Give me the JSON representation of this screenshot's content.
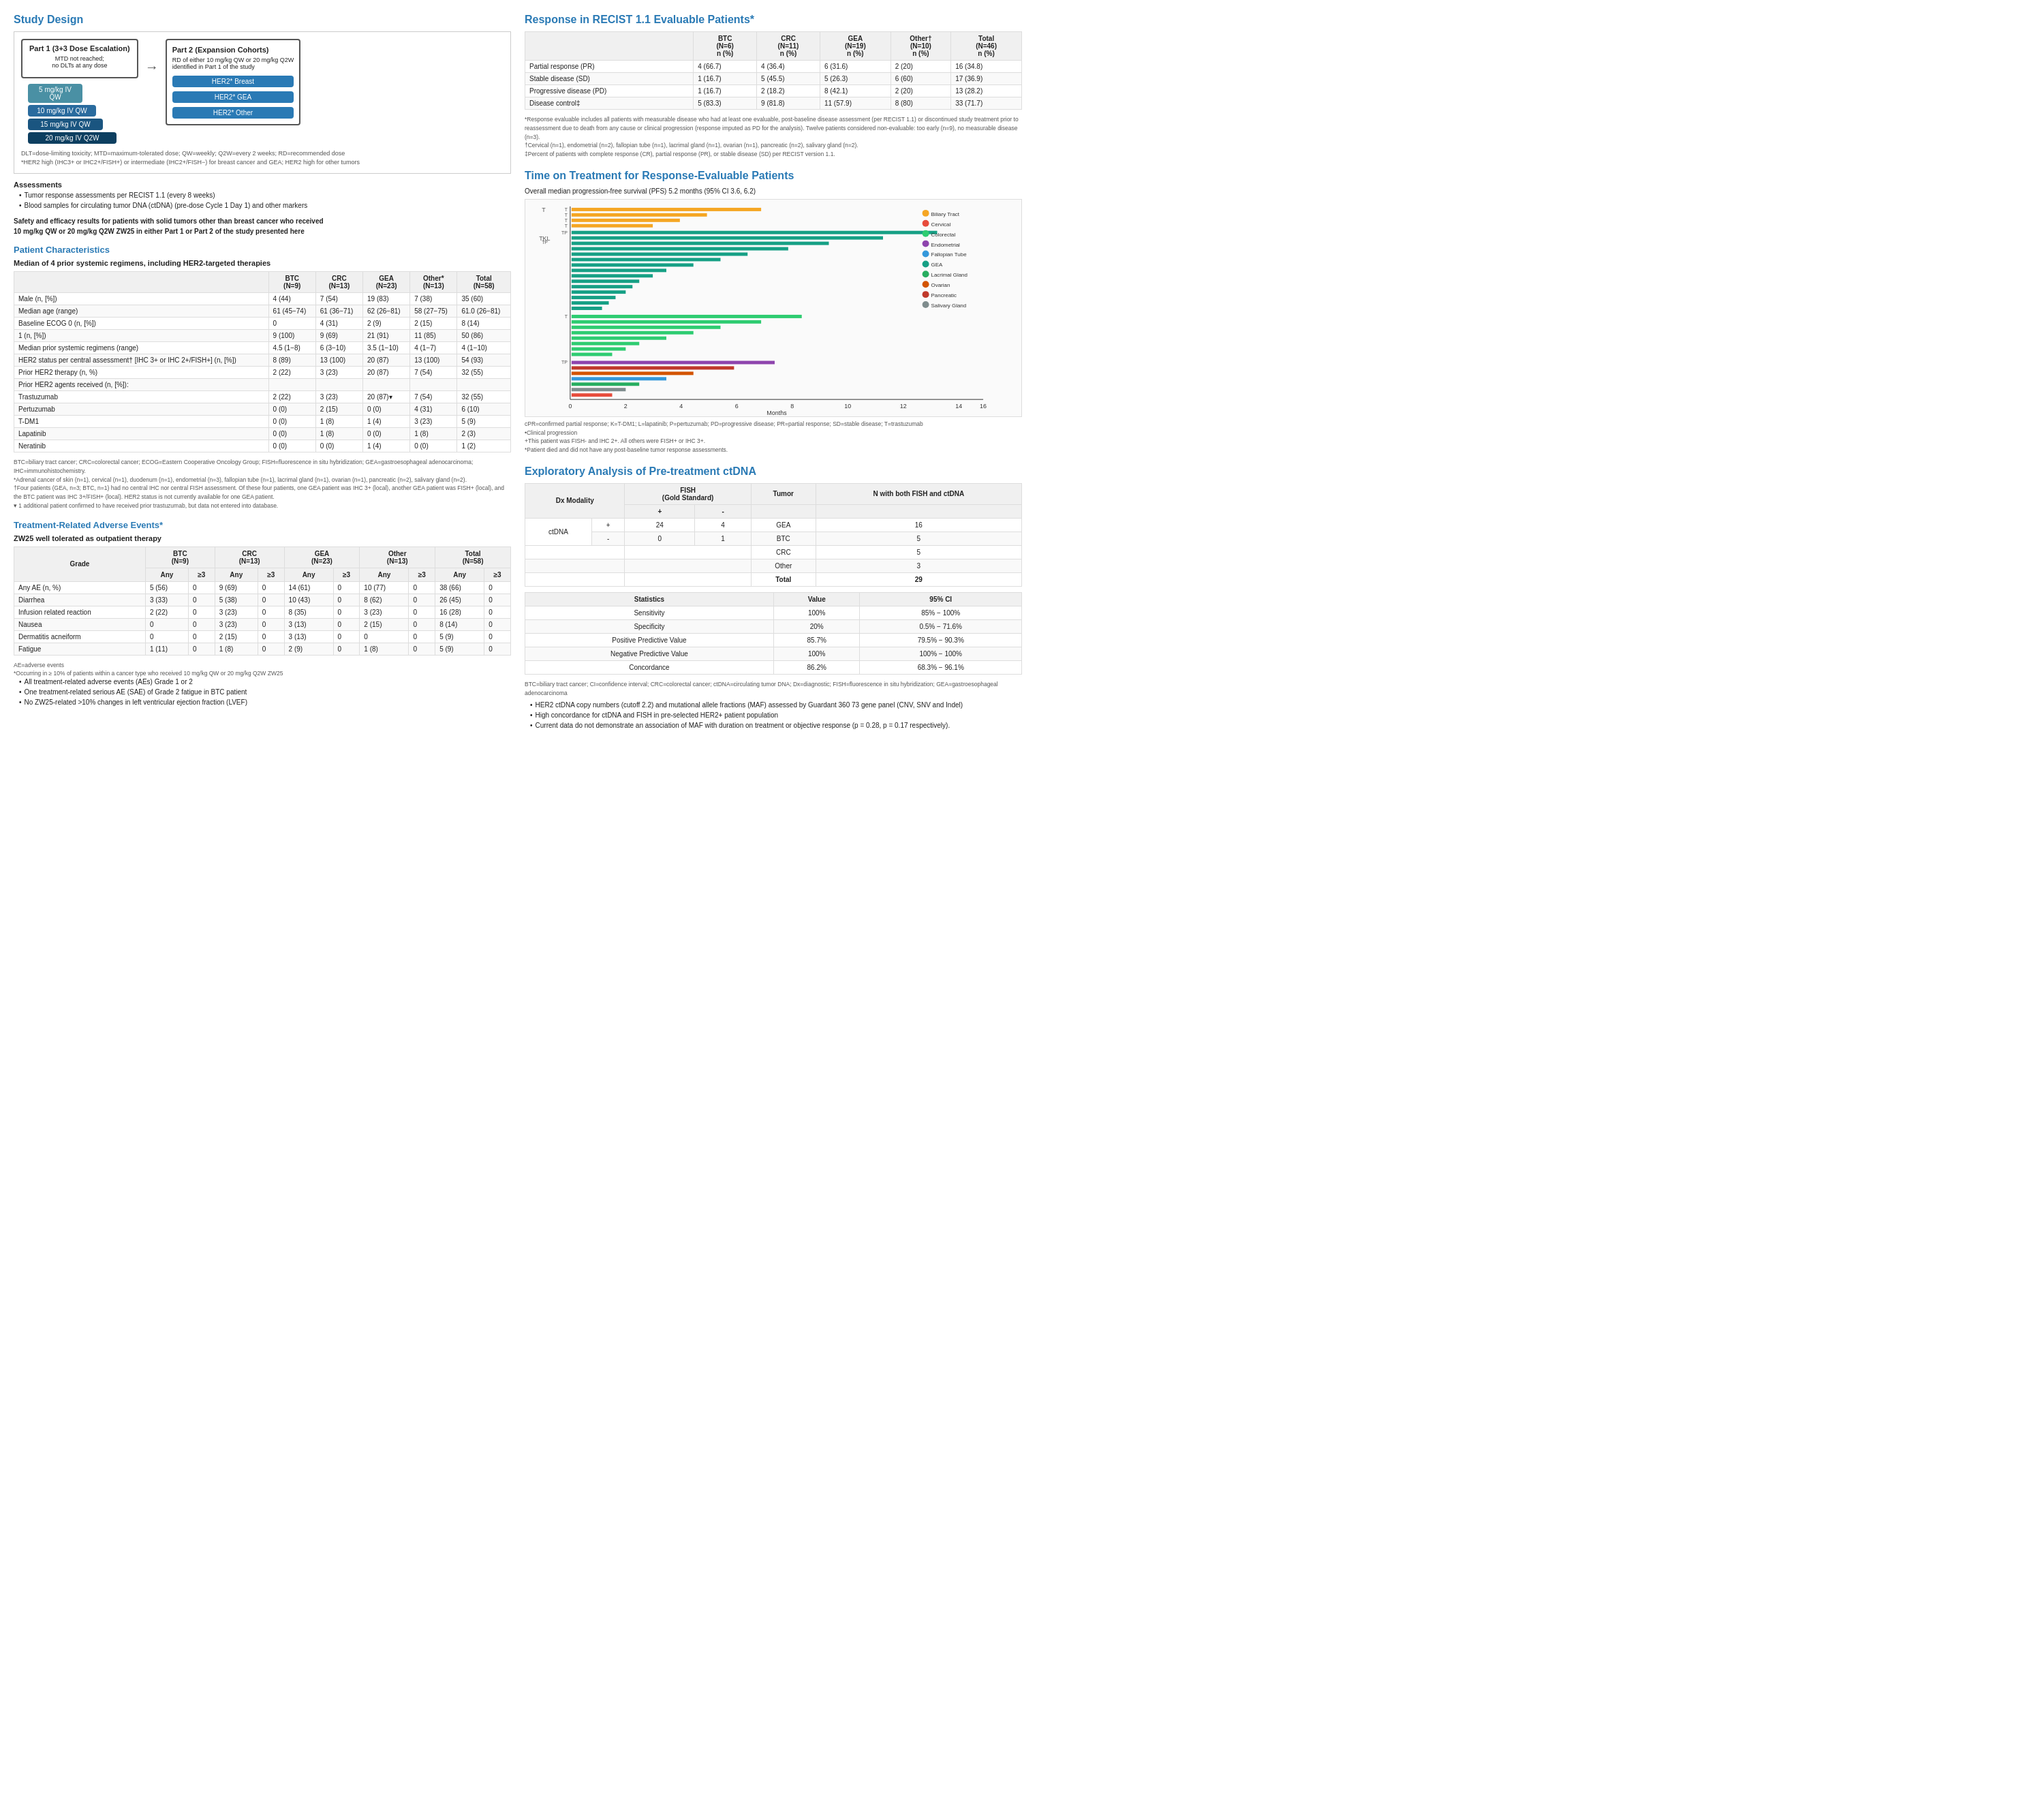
{
  "left": {
    "study_design": {
      "title": "Study Design",
      "part1_title": "Part 1 (3+3 Dose Escalation)",
      "part1_note": "MTD not reached;\nno DLTs at any dose",
      "part2_title": "Part 2 (Expansion Cohorts)",
      "part2_note": "RD of either 10 mg/kg QW or 20 mg/kg Q2W\nidentified in Part 1 of the study",
      "doses": [
        "5 mg/kg IV QW",
        "10 mg/kg IV QW",
        "15 mg/kg IV QW",
        "20 mg/kg IV Q2W"
      ],
      "her2_cohorts": [
        "HER2* Breast",
        "HER2* GEA",
        "HER2* Other"
      ],
      "footnote": "DLT=dose-limiting toxicity; MTD=maximum-tolerated dose; QW=weekly; Q2W=every 2 weeks; RD=recommended dose\n*HER2 high (IHC3+ or IHC2+/FISH+) or intermediate (IHC2+/FISH−) for breast cancer and GEA; HER2 high for other tumors",
      "assessments_title": "Assessments",
      "bullets": [
        "Tumor response assessments per RECIST 1.1 (every 8 weeks)",
        "Blood samples for circulating tumor DNA (ctDNA) (pre-dose Cycle 1 Day 1) and other markers"
      ],
      "safety_note": "Safety and efficacy results for patients with solid tumors other than breast cancer who received\n10 mg/kg QW or 20 mg/kg Q2W ZW25 in either Part 1 or Part 2 of the study presented here"
    },
    "patient_char": {
      "title": "Patient Characteristics",
      "subtitle": "Median of 4 prior systemic regimens, including HER2-targeted therapies",
      "headers": [
        "",
        "BTC\n(N=9)",
        "CRC\n(N=13)",
        "GEA\n(N=23)",
        "Other*\n(N=13)",
        "Total\n(N=58)"
      ],
      "rows": [
        {
          "label": "Male (n, [%])",
          "btc": "4 (44)",
          "crc": "7 (54)",
          "gea": "19 (83)",
          "other": "7 (38)",
          "total": "35 (60)"
        },
        {
          "label": "Median age (range)",
          "btc": "61 (45−74)",
          "crc": "61 (36−71)",
          "gea": "62 (26−81)",
          "other": "58 (27−75)",
          "total": "61.0 (26−81)"
        },
        {
          "label": "Baseline ECOG 0 (n, [%])",
          "btc": "0",
          "crc": "4 (31)",
          "gea": "2 (9)",
          "other": "2 (15)",
          "total": "8 (14)"
        },
        {
          "label": "1 (n, [%])",
          "btc": "9 (100)",
          "crc": "9 (69)",
          "gea": "21 (91)",
          "other": "11 (85)",
          "total": "50 (86)"
        },
        {
          "label": "Median prior systemic regimens (range)",
          "btc": "4.5 (1−8)",
          "crc": "6 (3−10)",
          "gea": "3.5 (1−10)",
          "other": "4 (1−7)",
          "total": "4 (1−10)"
        },
        {
          "label": "HER2 status per central assessment† [IHC 3+ or IHC 2+/FISH+] (n, [%])",
          "btc": "8 (89)",
          "crc": "13 (100)",
          "gea": "20 (87)",
          "other": "13 (100)",
          "total": "54 (93)"
        },
        {
          "label": "Prior HER2 therapy (n, %)",
          "btc": "2 (22)",
          "crc": "3 (23)",
          "gea": "20 (87)",
          "other": "7 (54)",
          "total": "32 (55)"
        },
        {
          "label": "Prior HER2 agents received (n, [%]):",
          "btc": "",
          "crc": "",
          "gea": "",
          "other": "",
          "total": ""
        },
        {
          "label": "  Trastuzumab",
          "btc": "2 (22)",
          "crc": "3 (23)",
          "gea": "20 (87)▾",
          "other": "7 (54)",
          "total": "32 (55)"
        },
        {
          "label": "  Pertuzumab",
          "btc": "0 (0)",
          "crc": "2 (15)",
          "gea": "0 (0)",
          "other": "4 (31)",
          "total": "6 (10)"
        },
        {
          "label": "  T-DM1",
          "btc": "0 (0)",
          "crc": "1 (8)",
          "gea": "1 (4)",
          "other": "3 (23)",
          "total": "5 (9)"
        },
        {
          "label": "  Lapatinib",
          "btc": "0 (0)",
          "crc": "1 (8)",
          "gea": "0 (0)",
          "other": "1 (8)",
          "total": "2 (3)"
        },
        {
          "label": "  Neratinib",
          "btc": "0 (0)",
          "crc": "0 (0)",
          "gea": "1 (4)",
          "other": "0 (0)",
          "total": "1 (2)"
        }
      ],
      "footnote": "BTC=biliary tract cancer; CRC=colorectal cancer; ECOG=Eastern Cooperative Oncology Group; FISH=fluorescence in situ hybridization; GEA=gastroesophageal adenocarcinoma;\nIHC=immunohistochemistry.\n*Adrenal cancer of skin (n=1), cervical (n=1), duodenum (n=1), endometrial (n=3), fallopian tube (n=1), lacrimal gland (n=1), ovarian (n=1), pancreatic (n=2), salivary gland (n=2).\n†Four patients (GEA, n=3; BTC, n=1) had no central IHC nor central FISH assessment. Of these four patients, one GEA patient was IHC 3+ (local), another GEA patient was FISH+ (local), and the BTC patient was IHC 3+/FISH+ (local). HER2 status is not currently available for one GEA patient.\n▾ 1 additional patient confirmed to have received prior trastuzumab, but data not entered into database."
    },
    "trae": {
      "title": "Treatment-Related Adverse Events*",
      "subtitle": "ZW25 well tolerated as outpatient therapy",
      "headers": [
        "Grade",
        "BTC (N=9) Any",
        "BTC (N=9) ≥3",
        "CRC (N=13) Any",
        "CRC (N=13) ≥3",
        "GEA (N=23) Any",
        "GEA (N=23) ≥3",
        "Other (N=13) Any",
        "Other (N=13) ≥3",
        "Total (N=58) Any",
        "Total (N=58) ≥3"
      ],
      "rows": [
        {
          "label": "Any AE (n, %)",
          "v": [
            "5 (56)",
            "0",
            "9 (69)",
            "0",
            "14 (61)",
            "0",
            "10 (77)",
            "0",
            "38 (66)",
            "0"
          ]
        },
        {
          "label": "Diarrhea",
          "v": [
            "3 (33)",
            "0",
            "5 (38)",
            "0",
            "10 (43)",
            "0",
            "8 (62)",
            "0",
            "26 (45)",
            "0"
          ]
        },
        {
          "label": "Infusion related reaction",
          "v": [
            "2 (22)",
            "0",
            "3 (23)",
            "0",
            "8 (35)",
            "0",
            "3 (23)",
            "0",
            "16 (28)",
            "0"
          ]
        },
        {
          "label": "Nausea",
          "v": [
            "0",
            "0",
            "3 (23)",
            "0",
            "3 (13)",
            "0",
            "2 (15)",
            "0",
            "8 (14)",
            "0"
          ]
        },
        {
          "label": "Dermatitis acneiform",
          "v": [
            "0",
            "0",
            "2 (15)",
            "0",
            "3 (13)",
            "0",
            "0",
            "0",
            "5 (9)",
            "0"
          ]
        },
        {
          "label": "Fatigue",
          "v": [
            "1 (11)",
            "0",
            "1 (8)",
            "0",
            "2 (9)",
            "0",
            "1 (8)",
            "0",
            "5 (9)",
            "0"
          ]
        }
      ],
      "footnote": "AE=adverse events\n*Occurring in ≥ 10% of patients within a cancer type who received 10 mg/kg QW or 20 mg/kg Q2W ZW25",
      "bullets": [
        "All treatment-related adverse events (AEs) Grade 1 or 2",
        "One treatment-related serious AE (SAE) of Grade 2 fatigue in BTC patient",
        "No ZW25-related >10% changes in left ventricular ejection fraction (LVEF)"
      ]
    }
  },
  "right": {
    "recist": {
      "title": "Response in RECIST 1.1 Evaluable Patients*",
      "headers": [
        "",
        "BTC (N=6) n (%)",
        "CRC (N=11) n (%)",
        "GEA (N=19) n (%)",
        "Other† (N=10) n (%)",
        "Total (N=46) n (%)"
      ],
      "rows": [
        {
          "label": "Partial response (PR)",
          "btc": "4 (66.7)",
          "crc": "4 (36.4)",
          "gea": "6 (31.6)",
          "other": "2 (20)",
          "total": "16 (34.8)"
        },
        {
          "label": "Stable disease (SD)",
          "btc": "1 (16.7)",
          "crc": "5 (45.5)",
          "gea": "5 (26.3)",
          "other": "6 (60)",
          "total": "17 (36.9)"
        },
        {
          "label": "Progressive disease (PD)",
          "btc": "1 (16.7)",
          "crc": "2 (18.2)",
          "gea": "8 (42.1)",
          "other": "2 (20)",
          "total": "13 (28.2)"
        },
        {
          "label": "Disease control‡",
          "btc": "5 (83.3)",
          "crc": "9 (81.8)",
          "gea": "11 (57.9)",
          "other": "8 (80)",
          "total": "33 (71.7)"
        }
      ],
      "footnote": "*Response evaluable includes all patients with measurable disease who had at least one evaluable, post-baseline disease assessment (per RECIST 1.1) or discontinued study treatment prior to reassessment due to death from any cause or clinical progression (response imputed as PD for the analysis). Twelve patients considered non-evaluable: too early (n=9), no measurable disease (n=3).\n†Cervical (n=1), endometrial (n=2), fallopian tube (n=1), lacrimal gland (n=1), ovarian (n=1), pancreatic (n=2), salivary gland (n=2).\n‡Percent of patients with complete response (CR), partial response (PR), or stable disease (SD) per RECIST version 1.1."
    },
    "time_on_treatment": {
      "title": "Time on Treatment for Response-Evaluable Patients",
      "subtitle": "Overall median progression-free survival (PFS) 5.2 months (95% CI 3.6, 6.2)",
      "chart_xlabel": "Months",
      "chart_xvals": [
        "0",
        "2",
        "4",
        "6",
        "8",
        "10",
        "12",
        "14",
        "16"
      ],
      "legend": [
        {
          "color": "#f5a623",
          "label": "Biliary Tract"
        },
        {
          "color": "#e74c3c",
          "label": "Cervical"
        },
        {
          "color": "#2ecc71",
          "label": "Colorectal"
        },
        {
          "color": "#8e44ad",
          "label": "Endometrial"
        },
        {
          "color": "#3498db",
          "label": "Fallopian Tube"
        },
        {
          "color": "#16a085",
          "label": "GEA"
        },
        {
          "color": "#27ae60",
          "label": "Lacrimal Gland"
        },
        {
          "color": "#d35400",
          "label": "Ovarian"
        },
        {
          "color": "#c0392b",
          "label": "Pancreatic"
        },
        {
          "color": "#7f8c8d",
          "label": "Salivary Gland"
        }
      ],
      "chart_footnote": "cPR=confirmed partial response; K=T-DM1; L=lapatinib; P=pertuzumab; PD=progressive disease; PR=partial response; SD=stable disease; T=trastuzumab\n•Clinical progression\n+This patient was FISH- and IHC 2+. All others were FISH+ or IHC 3+.\n*Patient died and did not have any post-baseline tumor response assessments."
    },
    "exploratory": {
      "title": "Exploratory Analysis of Pre-treatment ctDNA",
      "dx_modality_label": "Dx Modality",
      "fish_label": "FISH (Gold Standard)",
      "fish_plus": "+",
      "fish_minus": "-",
      "ctdna_label": "ctDNA",
      "ctdna_plus": "+",
      "ctdna_minus": "-",
      "tumor_label": "Tumor",
      "gea_label": "GEA",
      "gea_val": "16",
      "btc_label": "BTC",
      "btc_val": "5",
      "crc_label": "CRC",
      "crc_val": "5",
      "other_label": "Other",
      "other_val": "3",
      "total_label": "Total",
      "total_val": "29",
      "matrix_24": "24",
      "matrix_4": "4",
      "matrix_0": "0",
      "matrix_1": "1",
      "n_fish_ctdna_label": "N with both FISH and ctDNA",
      "stats_headers": [
        "Statistics",
        "Value",
        "95% CI"
      ],
      "stats_rows": [
        {
          "stat": "Sensitivity",
          "value": "100%",
          "ci": "85% − 100%"
        },
        {
          "stat": "Specificity",
          "value": "20%",
          "ci": "0.5% − 71.6%"
        },
        {
          "stat": "Positive Predictive Value",
          "value": "85.7%",
          "ci": "79.5% − 90.3%"
        },
        {
          "stat": "Negative Predictive Value",
          "value": "100%",
          "ci": "100% − 100%"
        },
        {
          "stat": "Concordance",
          "value": "86.2%",
          "ci": "68.3% − 96.1%"
        }
      ],
      "footnote": "BTC=biliary tract cancer; CI=confidence interval; CRC=colorectal cancer; ctDNA=circulating tumor DNA; Dx=diagnostic; FISH=fluorescence in situ hybridization; GEA=gastroesophageal adenocarcinoma",
      "bullets": [
        "HER2 ctDNA copy numbers (cutoff 2.2) and mutational allele fractions (MAF) assessed by Guardant 360 73 gene panel (CNV, SNV and Indel)",
        "High concordance for ctDNA and FISH in pre-selected HER2+ patient population",
        "Current data do not demonstrate an association of MAF with duration on treatment or objective response (p = 0.28, p = 0.17 respectively)."
      ]
    }
  }
}
